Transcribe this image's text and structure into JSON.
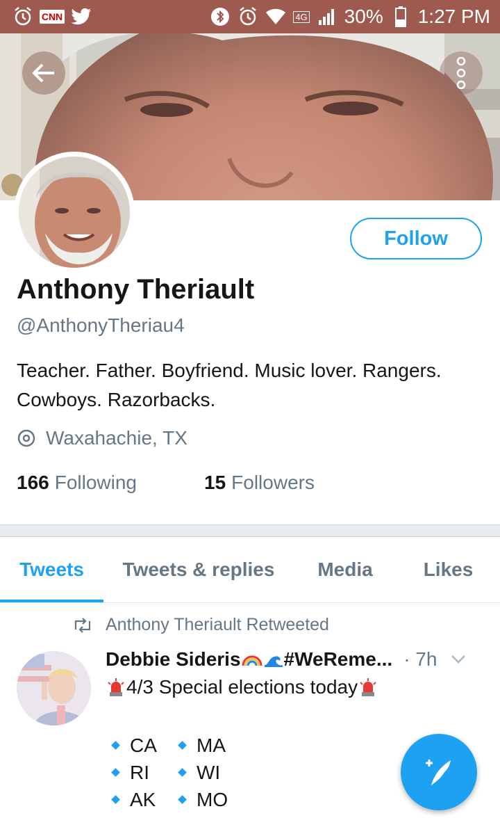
{
  "status_bar": {
    "left_icons": [
      "alarm-clock-icon",
      "cnn-icon",
      "twitter-bird-icon"
    ],
    "cnn_text": "CNN",
    "network": "4G",
    "battery": "30%",
    "time": "1:27 PM"
  },
  "header": {
    "back_icon": "arrow-left-icon",
    "more_icon": "more-vertical-icon"
  },
  "profile": {
    "follow_label": "Follow",
    "name": "Anthony Theriault",
    "handle": "@AnthonyTheriau4",
    "bio": "Teacher. Father. Boyfriend. Music lover. Rangers. Cowboys. Razorbacks.",
    "location": "Waxahachie, TX",
    "following_count": "166",
    "following_label": "Following",
    "followers_count": "15",
    "followers_label": "Followers"
  },
  "tabs": [
    {
      "label": "Tweets",
      "active": true
    },
    {
      "label": "Tweets & replies",
      "active": false
    },
    {
      "label": "Media",
      "active": false
    },
    {
      "label": "Likes",
      "active": false
    }
  ],
  "tweet": {
    "retweet_text": "Anthony Theriault Retweeted",
    "author_name": "Debbie Sideris",
    "author_name_suffix": "#WeReme...",
    "time": "· 7h",
    "text": "4/3 Special elections today",
    "states": [
      [
        "CA",
        "MA"
      ],
      [
        "RI",
        "WI"
      ],
      [
        "AK",
        "MO"
      ]
    ]
  },
  "colors": {
    "accent": "#1da1f2",
    "status_bar": "#9f5a4f",
    "secondary_text": "#657786"
  },
  "fab": {
    "icon": "compose-tweet-icon"
  }
}
